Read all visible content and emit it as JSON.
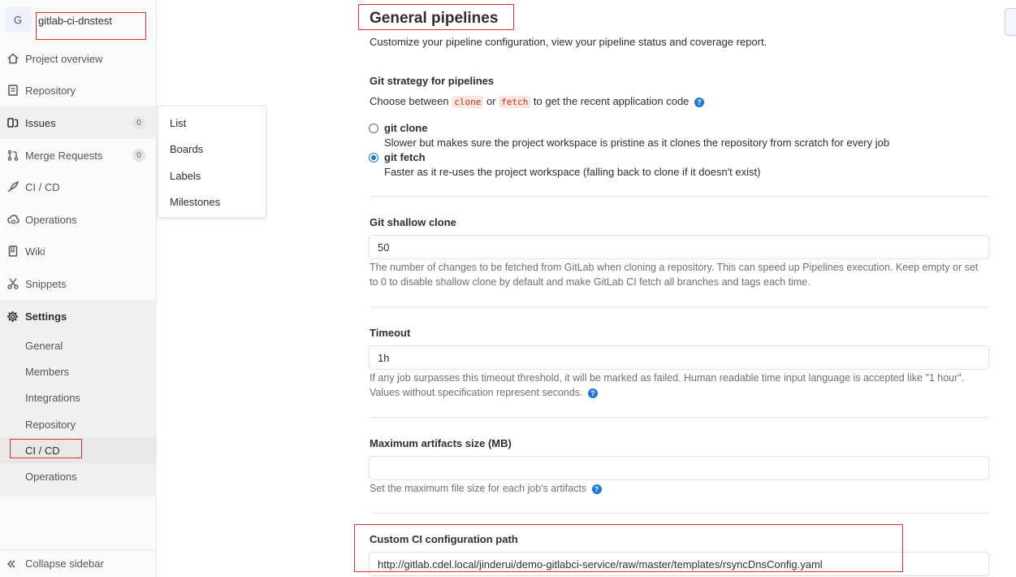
{
  "project": {
    "avatar_letter": "G",
    "name": "gitlab-ci-dnstest"
  },
  "sidebar": {
    "items": [
      {
        "label": "Project overview",
        "icon": "home-icon"
      },
      {
        "label": "Repository",
        "icon": "document-icon"
      },
      {
        "label": "Issues",
        "icon": "issues-icon",
        "count": "0"
      },
      {
        "label": "Merge Requests",
        "icon": "merge-request-icon",
        "count": "0"
      },
      {
        "label": "CI / CD",
        "icon": "rocket-icon"
      },
      {
        "label": "Operations",
        "icon": "cloud-gear-icon"
      },
      {
        "label": "Wiki",
        "icon": "book-icon"
      },
      {
        "label": "Snippets",
        "icon": "scissors-icon"
      }
    ],
    "settings": {
      "label": "Settings",
      "sub": [
        "General",
        "Members",
        "Integrations",
        "Repository",
        "CI / CD",
        "Operations"
      ]
    },
    "collapse_label": "Collapse sidebar"
  },
  "issues_flyout": [
    "List",
    "Boards",
    "Labels",
    "Milestones"
  ],
  "main": {
    "title": "General pipelines",
    "subtitle": "Customize your pipeline configuration, view your pipeline status and coverage report.",
    "git_strategy": {
      "label": "Git strategy for pipelines",
      "desc_prefix": "Choose between",
      "code_clone": "clone",
      "desc_or": "or",
      "code_fetch": "fetch",
      "desc_suffix": "to get the recent application code",
      "options": [
        {
          "title": "git clone",
          "desc": "Slower but makes sure the project workspace is pristine as it clones the repository from scratch for every job",
          "checked": false
        },
        {
          "title": "git fetch",
          "desc": "Faster as it re-uses the project workspace (falling back to clone if it doesn't exist)",
          "checked": true
        }
      ]
    },
    "shallow_clone": {
      "label": "Git shallow clone",
      "value": "50",
      "help_line1": "The number of changes to be fetched from GitLab when cloning a repository. This can speed up Pipelines execution. Keep empty or set",
      "help_line2": "to 0 to disable shallow clone by default and make GitLab CI fetch all branches and tags each time."
    },
    "timeout": {
      "label": "Timeout",
      "value": "1h",
      "help_line1": "If any job surpasses this timeout threshold, it will be marked as failed. Human readable time input language is accepted like \"1 hour\".",
      "help_line2": "Values without specification represent seconds."
    },
    "artifacts": {
      "label": "Maximum artifacts size (MB)",
      "value": "",
      "help": "Set the maximum file size for each job's artifacts"
    },
    "ci_config_path": {
      "label": "Custom CI configuration path",
      "value": "http://gitlab.cdel.local/jinderui/demo-gitlabci-service/raw/master/templates/rsyncDnsConfig.yaml"
    }
  },
  "colors": {
    "accent": "#1f78d1",
    "highlight_box": "#e03030"
  }
}
